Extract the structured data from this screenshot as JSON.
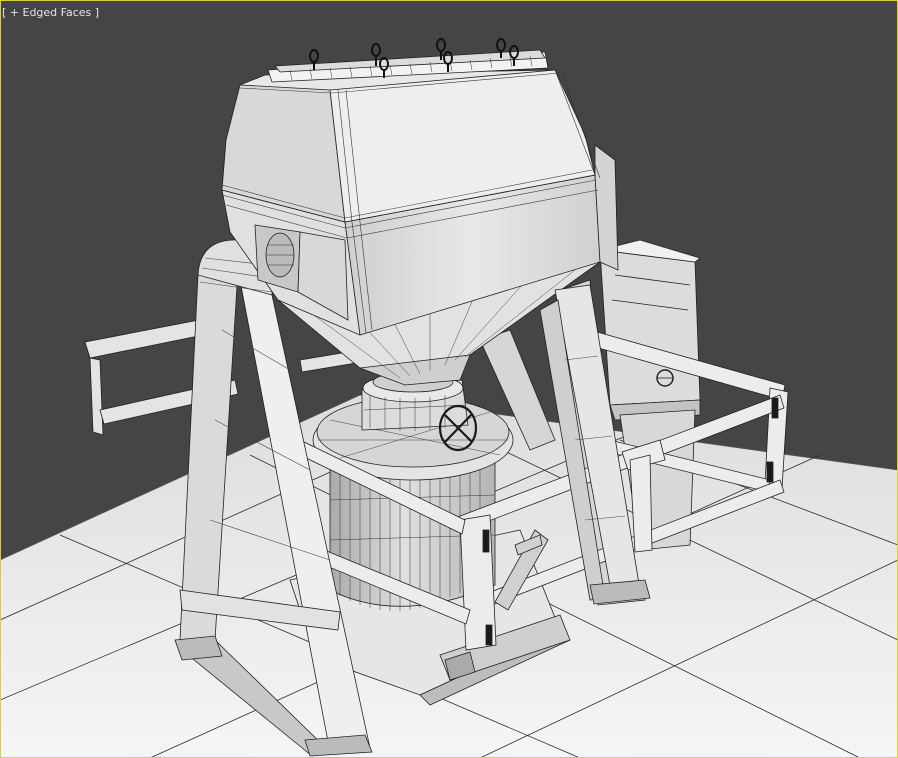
{
  "viewport": {
    "label": "[ + Edged Faces ]",
    "shading_mode": "Edged Faces",
    "colors": {
      "background": "#454545",
      "ground": "#efefef",
      "wire": "#222222",
      "active_border": "#d8cf3a"
    }
  }
}
